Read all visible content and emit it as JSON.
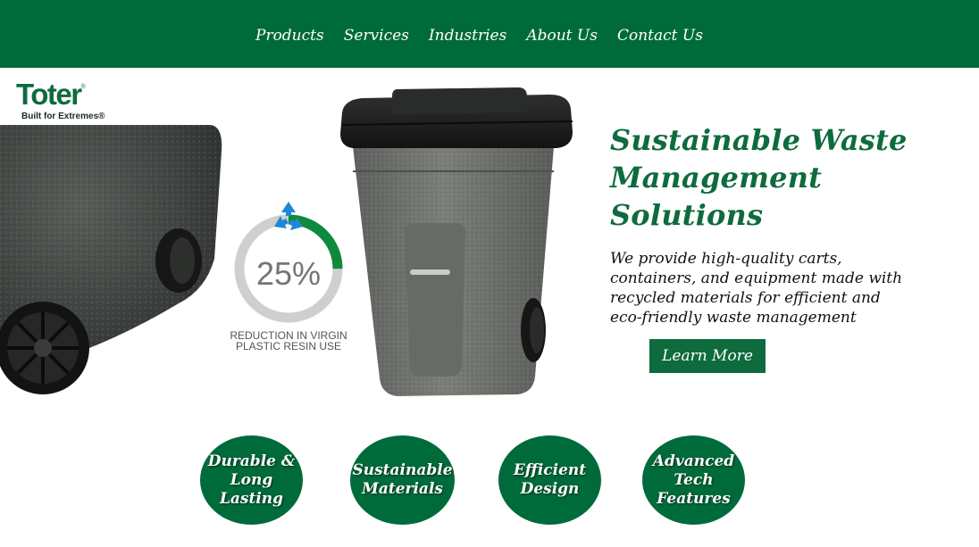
{
  "nav": {
    "items": [
      {
        "label": "Products"
      },
      {
        "label": "Services"
      },
      {
        "label": "Industries"
      },
      {
        "label": "About Us"
      },
      {
        "label": "Contact Us"
      }
    ]
  },
  "logo": {
    "brand": "Toter",
    "registered": "®",
    "tagline": "Built for Extremes®"
  },
  "hero": {
    "title": "Sustainable Waste Management Solutions",
    "description": "We provide high-quality carts, containers, and equipment made with recycled materials for efficient and eco-friendly waste management",
    "cta_label": "Learn More"
  },
  "stat": {
    "value": "25%",
    "caption_line1": "REDUCTION IN VIRGIN",
    "caption_line2": "PLASTIC RESIN USE",
    "fraction": 0.25
  },
  "features": [
    {
      "label": "Durable & Long Lasting"
    },
    {
      "label": "Sustainable Materials"
    },
    {
      "label": "Efficient Design"
    },
    {
      "label": "Advanced Tech Features"
    }
  ],
  "colors": {
    "brand_green": "#006b3a",
    "text_green": "#0e6b3d",
    "cart_body": "#6e716c",
    "cart_lid": "#1d1f1e",
    "recycle_blue": "#1e88d8"
  },
  "icons": {
    "recycle": "recycle-icon"
  }
}
